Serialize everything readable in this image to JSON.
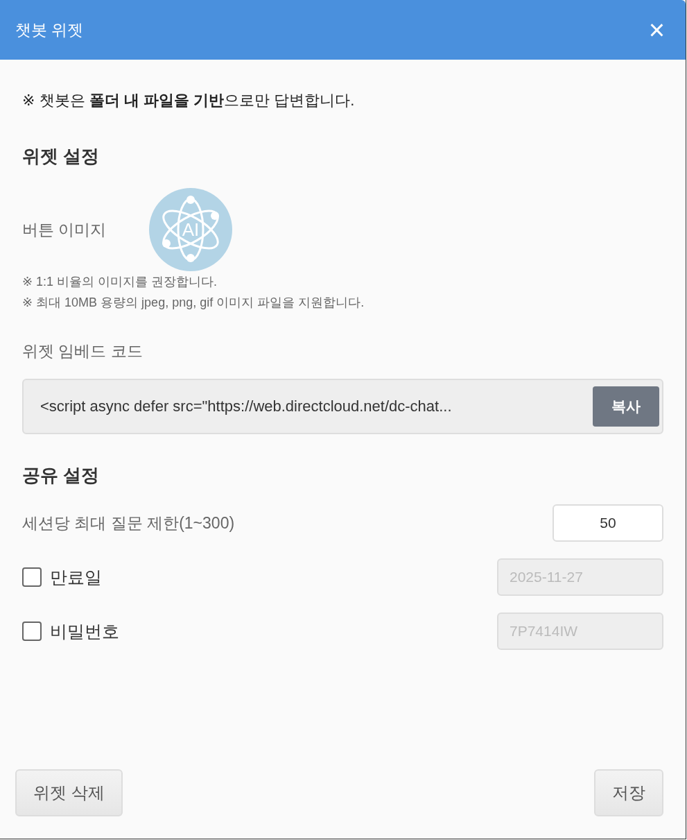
{
  "dialog": {
    "title": "챗봇 위젯",
    "close": "×"
  },
  "notice": "※ 챗봇은 **폴더 내 파일을 기반**으로만 답변합니다.",
  "widget_settings": {
    "heading": "위젯 설정",
    "button_image_label": "버튼 이미지",
    "button_image_text": "AI",
    "hints": [
      "※ 1:1 비율의 이미지를 권장합니다.",
      "※ 최대 10MB 용량의 jpeg, png, gif 이미지 파일을 지원합니다."
    ],
    "embed_label": "위젯 임베드 코드",
    "embed_code": "<script async defer src=\"https://web.directcloud.net/dc-chat...",
    "copy_button": "복사"
  },
  "share_settings": {
    "heading": "공유 설정",
    "rows": [
      {
        "kind": "number",
        "label": "세션당 최대 질문 제한(1~300)",
        "value": "50",
        "disabled": false
      },
      {
        "kind": "checkbox",
        "label": "만료일",
        "checked": false,
        "value": "2025-11-27",
        "disabled": true
      },
      {
        "kind": "checkbox",
        "label": "비밀번호",
        "checked": false,
        "value": "7P7414IW",
        "disabled": true
      }
    ]
  },
  "footer": {
    "delete_button": "위젯 삭제",
    "save_button": "저장"
  }
}
